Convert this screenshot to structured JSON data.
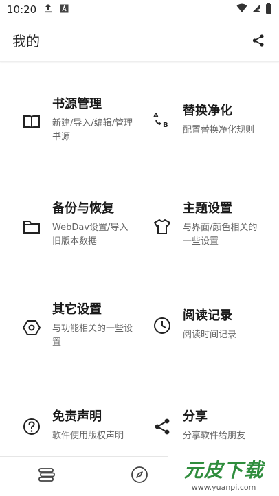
{
  "status_bar": {
    "time": "10:20",
    "icons": [
      "upload-icon",
      "a-notification-icon",
      "wifi-icon",
      "signal-icon",
      "battery-icon"
    ]
  },
  "app_bar": {
    "title": "我的",
    "share_icon": "share-icon"
  },
  "items": [
    {
      "title": "书源管理",
      "desc": "新建/导入/编辑/管理书源",
      "icon": "book-icon"
    },
    {
      "title": "替换净化",
      "desc": "配置替换净化规则",
      "icon": "a-to-b-icon"
    },
    {
      "title": "备份与恢复",
      "desc": "WebDav设置/导入旧版本数据",
      "icon": "folder-icon"
    },
    {
      "title": "主题设置",
      "desc": "与界面/颜色相关的一些设置",
      "icon": "tshirt-icon"
    },
    {
      "title": "其它设置",
      "desc": "与功能相关的一些设置",
      "icon": "hexagon-settings-icon"
    },
    {
      "title": "阅读记录",
      "desc": "阅读时间记录",
      "icon": "clock-icon"
    },
    {
      "title": "免责声明",
      "desc": "软件使用版权声明",
      "icon": "question-icon"
    },
    {
      "title": "分享",
      "desc": "分享软件给朋友",
      "icon": "share-icon"
    }
  ],
  "bottom_nav": {
    "items": [
      {
        "icon": "bookshelf-icon"
      },
      {
        "icon": "compass-icon"
      }
    ]
  },
  "watermark": {
    "main": "元皮下载",
    "url": "www.yuanpi.com"
  }
}
